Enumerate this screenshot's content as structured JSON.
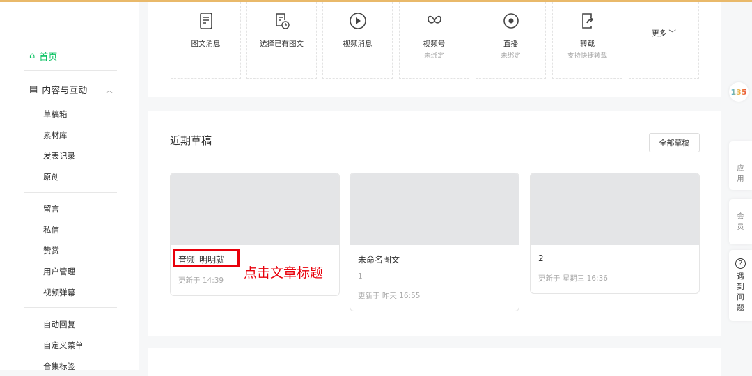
{
  "colors": {
    "accent": "#07c160",
    "topline": "#e9b96a",
    "annotation": "#e8000b"
  },
  "sidebar": {
    "home": "首页",
    "group": "内容与互动",
    "items1": [
      "草稿箱",
      "素材库",
      "发表记录",
      "原创"
    ],
    "items2": [
      "留言",
      "私信",
      "赞赏",
      "用户管理",
      "视频弹幕"
    ],
    "items3": [
      "自动回复",
      "自定义菜单",
      "合集标签"
    ]
  },
  "toolbar": [
    {
      "label": "图文消息",
      "status": "",
      "icon": "document-icon"
    },
    {
      "label": "选择已有图文",
      "status": "",
      "icon": "document-clock-icon"
    },
    {
      "label": "视频消息",
      "status": "",
      "icon": "play-icon"
    },
    {
      "label": "视频号",
      "status": "未绑定",
      "icon": "channels-icon"
    },
    {
      "label": "直播",
      "status": "未绑定",
      "icon": "live-icon"
    },
    {
      "label": "转载",
      "status": "支持快捷转载",
      "icon": "share-icon"
    }
  ],
  "more": "更多",
  "drafts": {
    "title": "近期草稿",
    "all_button": "全部草稿",
    "cards": [
      {
        "title": "音频–明明就",
        "desc": "",
        "meta": "更新于 14:39"
      },
      {
        "title": "未命名图文",
        "desc": "1",
        "meta": "更新于 昨天 16:55"
      },
      {
        "title": "2",
        "desc": "",
        "meta": "更新于 星期三 16:36"
      }
    ]
  },
  "annotation": "点击文章标题",
  "right": {
    "logo": "135",
    "apps": "应用",
    "member": "会员",
    "help": "遇到问题"
  }
}
